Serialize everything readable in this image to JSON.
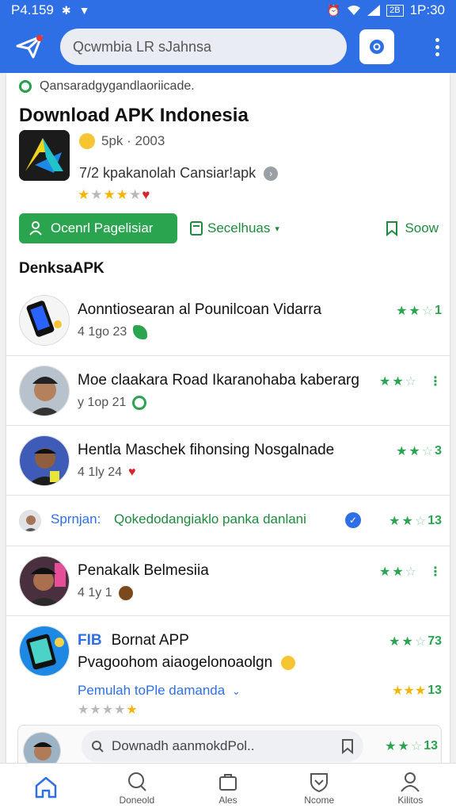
{
  "status_bar": {
    "time_left": "P4.159",
    "battery_label": "2B",
    "time_right": "1P:30"
  },
  "search": {
    "value": "Qcwmbia LR sJahnsa"
  },
  "header": {
    "breadcrumb": "Qansaradgygandlaoriicade.",
    "title": "Download APK Indonesia",
    "meta": "5pk · 2003",
    "developer": "7/2 kpakanolah Cansiar!apk",
    "rating_stars": 4
  },
  "actions": {
    "primary_label": "Ocenrl Pagelisiar",
    "secondary_label": "Secelhuas",
    "save_label": "Soow"
  },
  "section": {
    "title": "DenksaAPK"
  },
  "list": [
    {
      "title": "Aonntiosearan al Pounilcoan Vidarra",
      "sub": "4 1go  23",
      "rating": "1"
    },
    {
      "title": "Moe claakara Road Ikaranohaba kaberarg",
      "sub": "y 1op  21",
      "rating": ""
    },
    {
      "title": "Hentla Maschek fihonsing Nosgalnade",
      "sub": "4 1ly  24",
      "rating": "3"
    },
    {
      "title": "Sprnjan:",
      "title2": "Qokedodangiaklo panka danlani",
      "rating": "13"
    },
    {
      "title": "Penakalk Belmesiia",
      "sub": "4 1y  1",
      "rating": ""
    },
    {
      "title": "Bornat APP",
      "badge": "FIB",
      "sub": "Pvagoohom aiaogelonoaolgn",
      "link": "Pemulah toPle damanda",
      "rating": "73",
      "rating2": "13"
    }
  ],
  "bottom_search": {
    "value": "Downadh aanmokdPol..",
    "rating": "13"
  },
  "bottom_nav": [
    {
      "label": ""
    },
    {
      "label": "Doneold"
    },
    {
      "label": "Ales"
    },
    {
      "label": "Ncome"
    },
    {
      "label": "Kilitos"
    }
  ],
  "colors": {
    "brand_blue": "#2f6fe6",
    "accent_green": "#2aa44f",
    "star_gold": "#f5b400"
  }
}
